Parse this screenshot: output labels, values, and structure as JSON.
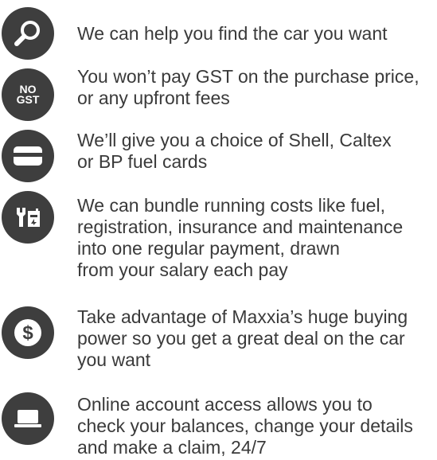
{
  "items": [
    {
      "icon": "search-icon",
      "lines": [
        "We can help you find the car you want"
      ]
    },
    {
      "icon": "no-gst-icon",
      "icon_text": [
        "NO",
        "GST"
      ],
      "lines": [
        "You won’t pay GST on the purchase price,",
        "or any upfront fees"
      ]
    },
    {
      "icon": "fuel-card-icon",
      "lines": [
        "We’ll give you a choice of Shell, Caltex",
        "or BP fuel cards"
      ]
    },
    {
      "icon": "maintenance-icon",
      "lines": [
        "We can bundle running costs like fuel,",
        "registration, insurance and maintenance",
        "into one regular payment, drawn",
        "from your salary each pay"
      ]
    },
    {
      "icon": "dollar-icon",
      "lines": [
        "Take advantage of Maxxia’s huge buying",
        "power so you get a great deal on the car",
        "you want"
      ]
    },
    {
      "icon": "laptop-icon",
      "lines": [
        "Online account access allows you to",
        "check your balances, change your details",
        "and make a claim, 24/7"
      ]
    }
  ],
  "colors": {
    "icon_bg": "#3e3e3e",
    "text": "#3a3a3a",
    "icon_fg": "#ffffff"
  }
}
